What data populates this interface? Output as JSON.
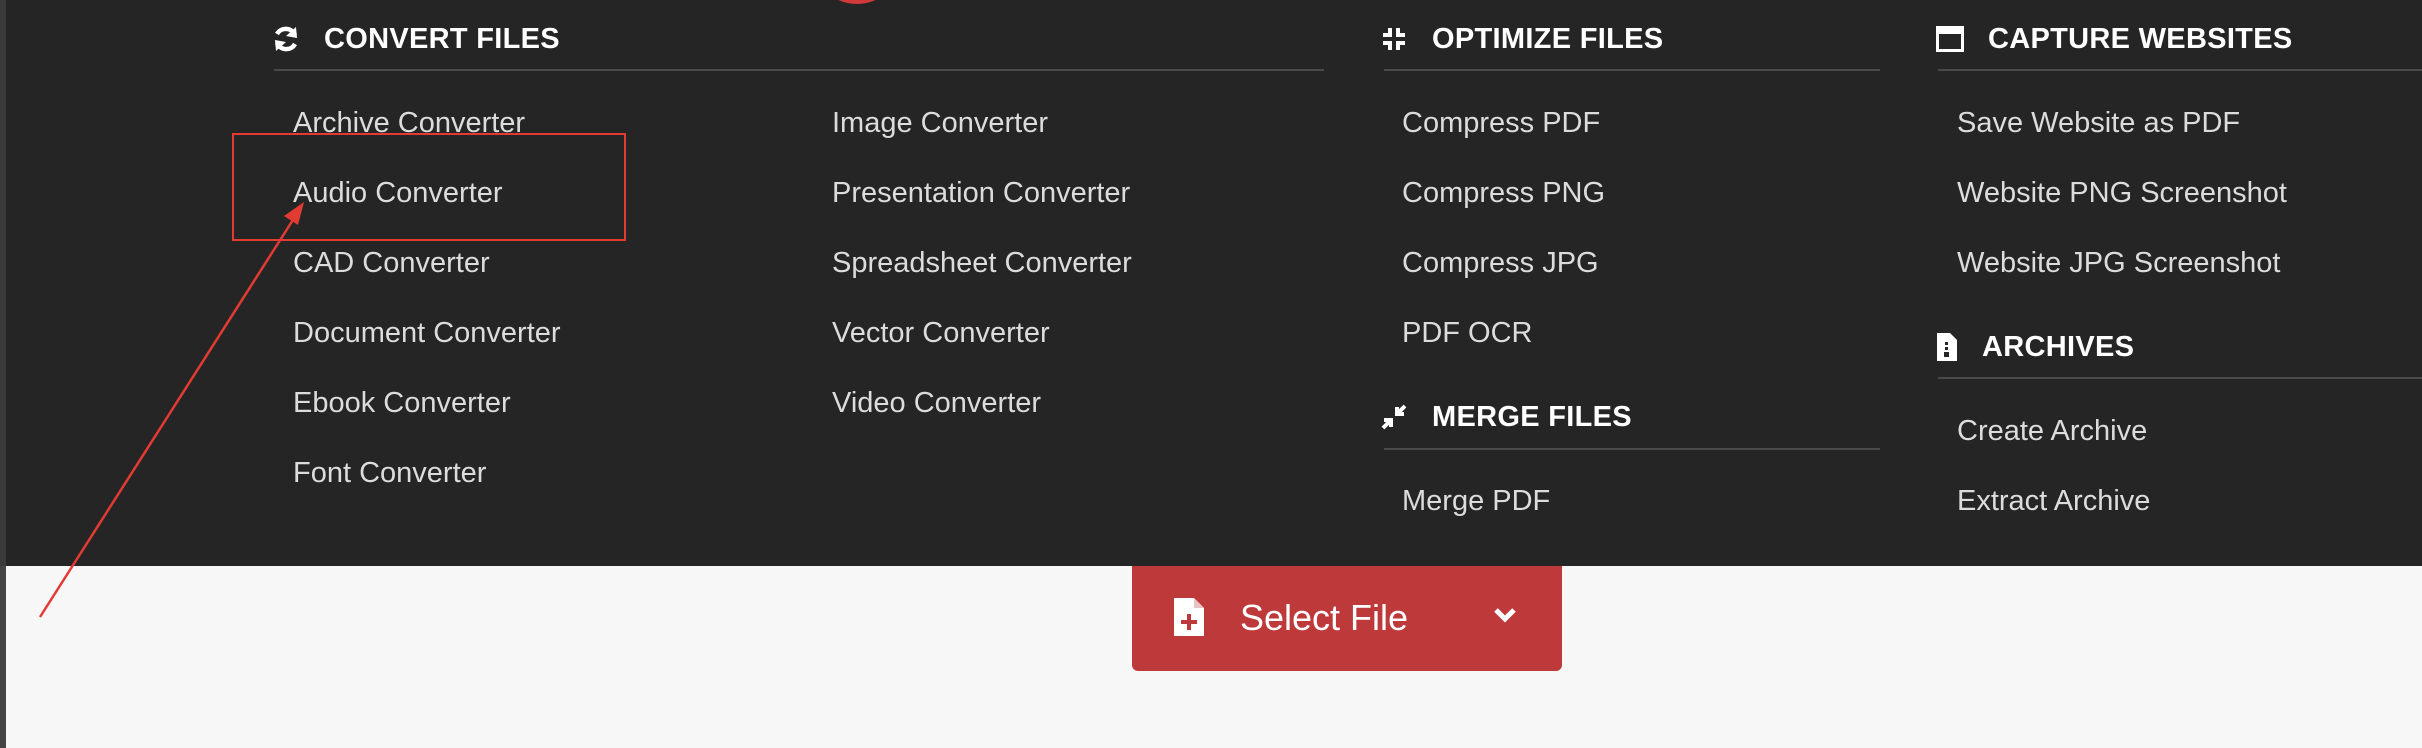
{
  "convert": {
    "title": "CONVERT FILES",
    "icon": "refresh-icon",
    "col1": [
      "Archive Converter",
      "Audio Converter",
      "CAD Converter",
      "Document Converter",
      "Ebook Converter",
      "Font Converter"
    ],
    "col2": [
      "Image Converter",
      "Presentation Converter",
      "Spreadsheet Converter",
      "Vector Converter",
      "Video Converter"
    ]
  },
  "optimize": {
    "title": "OPTIMIZE FILES",
    "icon": "compress-icon",
    "items": [
      "Compress PDF",
      "Compress PNG",
      "Compress JPG",
      "PDF OCR"
    ]
  },
  "merge": {
    "title": "MERGE FILES",
    "icon": "merge-icon",
    "items": [
      "Merge PDF"
    ]
  },
  "capture": {
    "title": "CAPTURE WEBSITES",
    "icon": "browser-window-icon",
    "items": [
      "Save Website as PDF",
      "Website PNG Screenshot",
      "Website JPG Screenshot"
    ]
  },
  "archives": {
    "title": "ARCHIVES",
    "icon": "archive-file-icon",
    "items": [
      "Create Archive",
      "Extract Archive"
    ]
  },
  "select_file": {
    "label": "Select File",
    "icon": "file-add-icon",
    "dropdown_icon": "chevron-down-icon"
  },
  "colors": {
    "menu_bg": "#252525",
    "page_bg": "#f7f7f7",
    "accent": "#be3a3a",
    "annotation": "#e23b32"
  }
}
